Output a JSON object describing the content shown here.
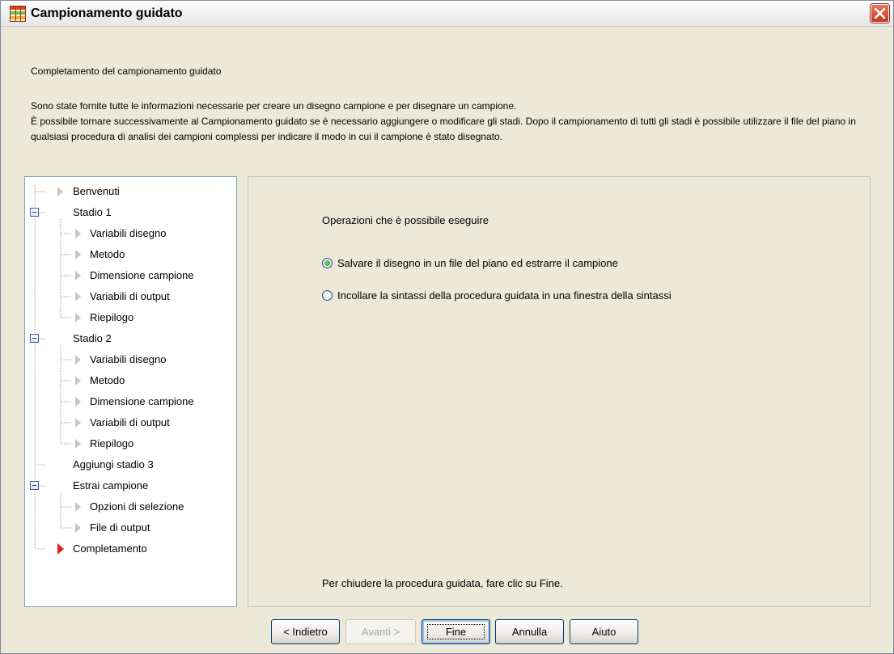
{
  "window": {
    "title": "Campionamento guidato",
    "accent_color": "#003c74",
    "close_icon": "close-icon"
  },
  "intro": {
    "heading": "Completamento del campionamento guidato",
    "line1": "Sono state fornite tutte le informazioni necessarie per creare un disegno campione e per disegnare un campione.",
    "line2": "È possibile tornare successivamente al Campionamento guidato se è necessario aggiungere o modificare gli stadi. Dopo il campionamento di tutti gli stadi è possibile utilizzare il file del piano in qualsiasi procedura di analisi dei campioni complessi per indicare il modo in cui il campione è stato disegnato."
  },
  "tree": {
    "items": [
      {
        "label": "Benvenuti"
      },
      {
        "label": "Stadio 1"
      },
      {
        "label": "Variabili disegno"
      },
      {
        "label": "Metodo"
      },
      {
        "label": "Dimensione campione"
      },
      {
        "label": "Variabili di output"
      },
      {
        "label": "Riepilogo"
      },
      {
        "label": "Stadio 2"
      },
      {
        "label": "Variabili disegno"
      },
      {
        "label": "Metodo"
      },
      {
        "label": "Dimensione campione"
      },
      {
        "label": "Variabili di output"
      },
      {
        "label": "Riepilogo"
      },
      {
        "label": "Aggiungi stadio 3"
      },
      {
        "label": "Estrai campione"
      },
      {
        "label": "Opzioni di selezione"
      },
      {
        "label": "File di output"
      },
      {
        "label": "Completamento"
      }
    ],
    "active_color": "#e0201a"
  },
  "content": {
    "heading": "Operazioni che è possibile eseguire",
    "options": [
      {
        "label": "Salvare il disegno in un file del piano ed estrarre il campione",
        "selected": true
      },
      {
        "label": "Incollare la sintassi della procedura guidata in una finestra della sintassi",
        "selected": false
      }
    ],
    "finish_note": "Per chiudere la procedura guidata, fare clic su Fine."
  },
  "buttons": {
    "back": "< Indietro",
    "next": "Avanti >",
    "finish": "Fine",
    "cancel": "Annulla",
    "help": "Aiuto"
  }
}
